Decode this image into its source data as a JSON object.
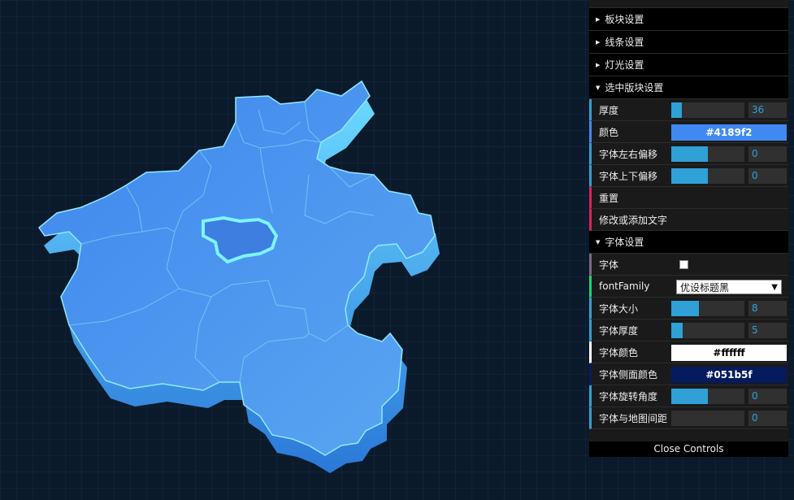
{
  "folders": {
    "block": "板块设置",
    "line": "线条设置",
    "light": "灯光设置",
    "selected": "选中版块设置",
    "font": "字体设置"
  },
  "selected": {
    "thickness": {
      "label": "厚度",
      "value": "36",
      "fraction": 0.14
    },
    "color": {
      "label": "颜色",
      "value": "#4189f2"
    },
    "offset_x": {
      "label": "字体左右偏移",
      "value": "0",
      "fraction": 0.5
    },
    "offset_y": {
      "label": "字体上下偏移",
      "value": "0",
      "fraction": 0.5
    },
    "reset": "重置",
    "edit_text": "修改或添加文字"
  },
  "font": {
    "font": {
      "label": "字体"
    },
    "family": {
      "label": "fontFamily",
      "value": "优设标题黑"
    },
    "size": {
      "label": "字体大小",
      "value": "8",
      "fraction": 0.38
    },
    "depth": {
      "label": "字体厚度",
      "value": "5",
      "fraction": 0.16
    },
    "color": {
      "label": "字体颜色",
      "value": "#ffffff"
    },
    "side_color": {
      "label": "字体侧面颜色",
      "value": "#051b5f"
    },
    "rotation": {
      "label": "字体旋转角度",
      "value": "0",
      "fraction": 0.5
    },
    "distance": {
      "label": "字体与地图间距",
      "value": "0",
      "fraction": 0.0
    }
  },
  "close_controls": "Close Controls",
  "colors": {
    "map_top": "#4189f2",
    "map_side": "#3a8fe0",
    "map_edge": "#8fe9ff",
    "highlight": "#7ff4ff"
  }
}
